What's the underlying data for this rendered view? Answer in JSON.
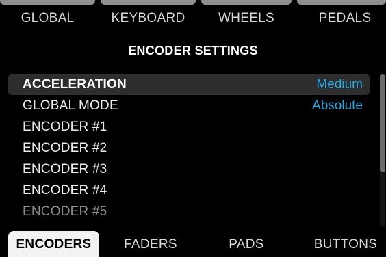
{
  "top_tabs": [
    "GLOBAL",
    "KEYBOARD",
    "WHEELS",
    "PEDALS"
  ],
  "page_title": "ENCODER SETTINGS",
  "settings": [
    {
      "name": "ACCELERATION",
      "value": "Medium"
    },
    {
      "name": "GLOBAL MODE",
      "value": "Absolute"
    },
    {
      "name": "ENCODER #1",
      "value": ""
    },
    {
      "name": "ENCODER #2",
      "value": ""
    },
    {
      "name": "ENCODER #3",
      "value": ""
    },
    {
      "name": "ENCODER #4",
      "value": ""
    },
    {
      "name": "ENCODER #5",
      "value": ""
    }
  ],
  "selected_setting": "ACCELERATION",
  "bottom_tabs": [
    "ENCODERS",
    "FADERS",
    "PADS",
    "BUTTONS"
  ],
  "active_bottom_tab": "ENCODERS",
  "colors": {
    "background": "#000000",
    "value_text": "#2ba8e0",
    "selected_row": "#2d2d2d",
    "active_tab": "#f2f2f2",
    "tab_caps": "#8f8f8f"
  }
}
